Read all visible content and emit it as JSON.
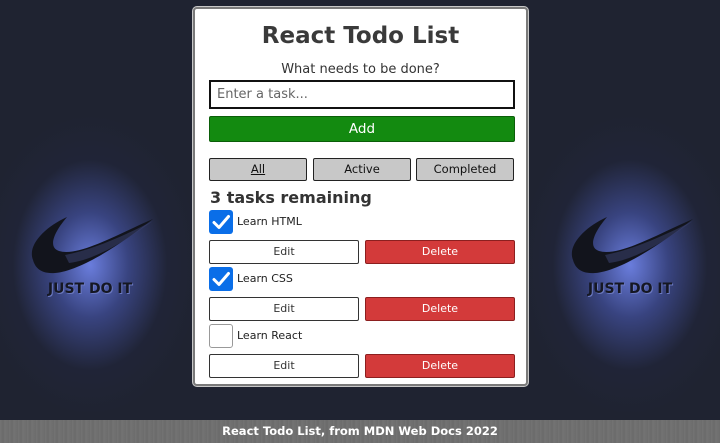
{
  "app": {
    "title": "React Todo List",
    "subtitle": "What needs to be done?"
  },
  "form": {
    "input_value": "",
    "input_placeholder": "Enter a task...",
    "add_label": "Add"
  },
  "filters": [
    {
      "label": "All",
      "selected": true
    },
    {
      "label": "Active",
      "selected": false
    },
    {
      "label": "Completed",
      "selected": false
    }
  ],
  "remaining_text": "3 tasks remaining",
  "todos": [
    {
      "name": "Learn HTML",
      "completed": true,
      "edit_label": "Edit",
      "delete_label": "Delete"
    },
    {
      "name": "Learn CSS",
      "completed": true,
      "edit_label": "Edit",
      "delete_label": "Delete"
    },
    {
      "name": "Learn React",
      "completed": false,
      "edit_label": "Edit",
      "delete_label": "Delete"
    }
  ],
  "background": {
    "logo_text": "JUST DO IT"
  },
  "footer": {
    "text": "React Todo List, from MDN Web Docs 2022"
  },
  "colors": {
    "add_button": "#138a10",
    "delete_button": "#d33a3a",
    "checkbox_checked": "#0a6ee8",
    "filter_button": "#c8c8c8",
    "background": "#1f2331"
  }
}
